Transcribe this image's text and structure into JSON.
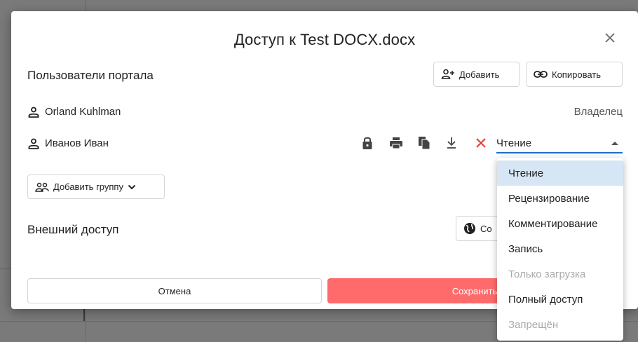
{
  "dialog": {
    "title": "Доступ к Test DOCX.docx",
    "close_icon": "close-icon"
  },
  "portal": {
    "section_title": "Пользователи портала",
    "add_label": "Добавить",
    "copy_label": "Копировать"
  },
  "users": [
    {
      "name": "Orland Kuhlman",
      "role": "Владелец"
    },
    {
      "name": "Иванов Иван",
      "role": "Чтение"
    }
  ],
  "permissions_icons": [
    "lock-icon",
    "print-icon",
    "copy-icon",
    "download-icon",
    "remove-icon"
  ],
  "add_group": {
    "label": "Добавить группу"
  },
  "external": {
    "section_title": "Внешний доступ",
    "create_label_visible": "Со"
  },
  "footer": {
    "cancel_label": "Отмена",
    "save_label_visible": "Сохранить"
  },
  "role_dropdown": {
    "options": [
      {
        "label": "Чтение",
        "state": "selected"
      },
      {
        "label": "Рецензирование",
        "state": "normal"
      },
      {
        "label": "Комментирование",
        "state": "normal"
      },
      {
        "label": "Запись",
        "state": "normal"
      },
      {
        "label": "Только загрузка",
        "state": "disabled"
      },
      {
        "label": "Полный доступ",
        "state": "normal"
      },
      {
        "label": "Запрещён",
        "state": "disabled"
      }
    ]
  },
  "colors": {
    "accent_blue": "#1f6fc7",
    "save_red": "#ff6b6b",
    "remove_red": "#e53935",
    "selected_bg": "#d7e6f5"
  }
}
